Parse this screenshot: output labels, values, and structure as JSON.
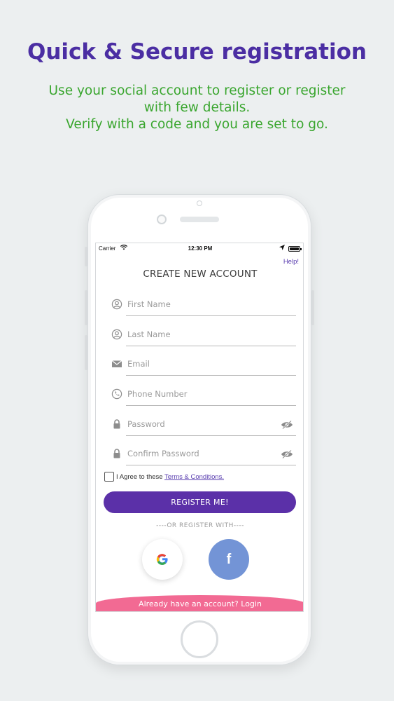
{
  "promo": {
    "headline": "Quick & Secure registration",
    "sub_lines": [
      "Use your social account to register or register",
      "with few details.",
      "Verify with a code and you are set to go."
    ]
  },
  "colors": {
    "headline": "#4b2ea3",
    "subline": "#3aa62f",
    "primary_button": "#5b30a8",
    "footer": "#f26a93",
    "facebook": "#7394d6"
  },
  "status_bar": {
    "carrier": "Carrier",
    "time": "12:30 PM",
    "icons": [
      "wifi-icon",
      "location-arrow-icon",
      "battery-icon"
    ]
  },
  "screen": {
    "help": "Help!",
    "title": "CREATE NEW ACCOUNT",
    "fields": [
      {
        "placeholder": "First Name",
        "icon": "user-icon"
      },
      {
        "placeholder": "Last Name",
        "icon": "user-icon"
      },
      {
        "placeholder": "Email",
        "icon": "envelope-icon"
      },
      {
        "placeholder": "Phone Number",
        "icon": "phone-icon"
      },
      {
        "placeholder": "Password",
        "icon": "lock-icon",
        "toggle_icon": "eye-off-icon"
      },
      {
        "placeholder": "Confirm Password",
        "icon": "lock-icon",
        "toggle_icon": "eye-off-icon"
      }
    ],
    "agree_text": "I Agree to these",
    "terms_link": "Terms & Conditions.",
    "register_button": "REGISTER ME!",
    "or_text": "----OR REGISTER WITH----",
    "social": {
      "google_icon": "google-icon",
      "facebook_label": "f"
    },
    "footer": "Already have an account? Login"
  }
}
